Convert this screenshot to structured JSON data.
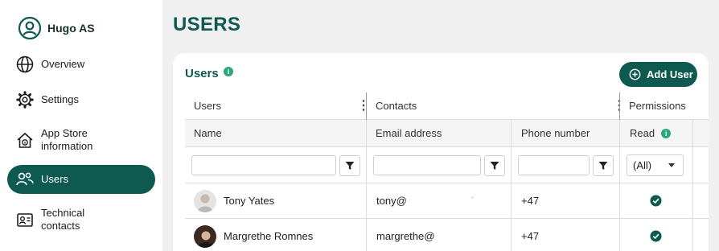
{
  "sidebar": {
    "org_name": "Hugo AS",
    "items": [
      {
        "label": "Overview",
        "icon": "globe-icon"
      },
      {
        "label": "Settings",
        "icon": "gear-icon"
      },
      {
        "label": "App Store information",
        "icon": "home-info-icon"
      },
      {
        "label": "Users",
        "icon": "users-icon",
        "active": true
      },
      {
        "label": "Technical contacts",
        "icon": "contact-card-icon"
      }
    ]
  },
  "page": {
    "title": "USERS"
  },
  "card": {
    "title": "Users",
    "info_icon": "i",
    "add_user_label": "Add User"
  },
  "table": {
    "groups": [
      "Users",
      "Contacts",
      "Permissions"
    ],
    "columns": [
      "Name",
      "Email address",
      "Phone number",
      "Read"
    ],
    "read_filter_value": "(All)",
    "rows": [
      {
        "name": "Tony Yates",
        "email": "tony@",
        "email_mark": "`",
        "phone": "+47",
        "read": true
      },
      {
        "name": "Margrethe Romnes",
        "email": "margrethe@",
        "phone": "+47",
        "read": true
      }
    ]
  },
  "colors": {
    "accent": "#0e5a51",
    "info": "#2aa87c",
    "background": "#f0f0f0"
  }
}
